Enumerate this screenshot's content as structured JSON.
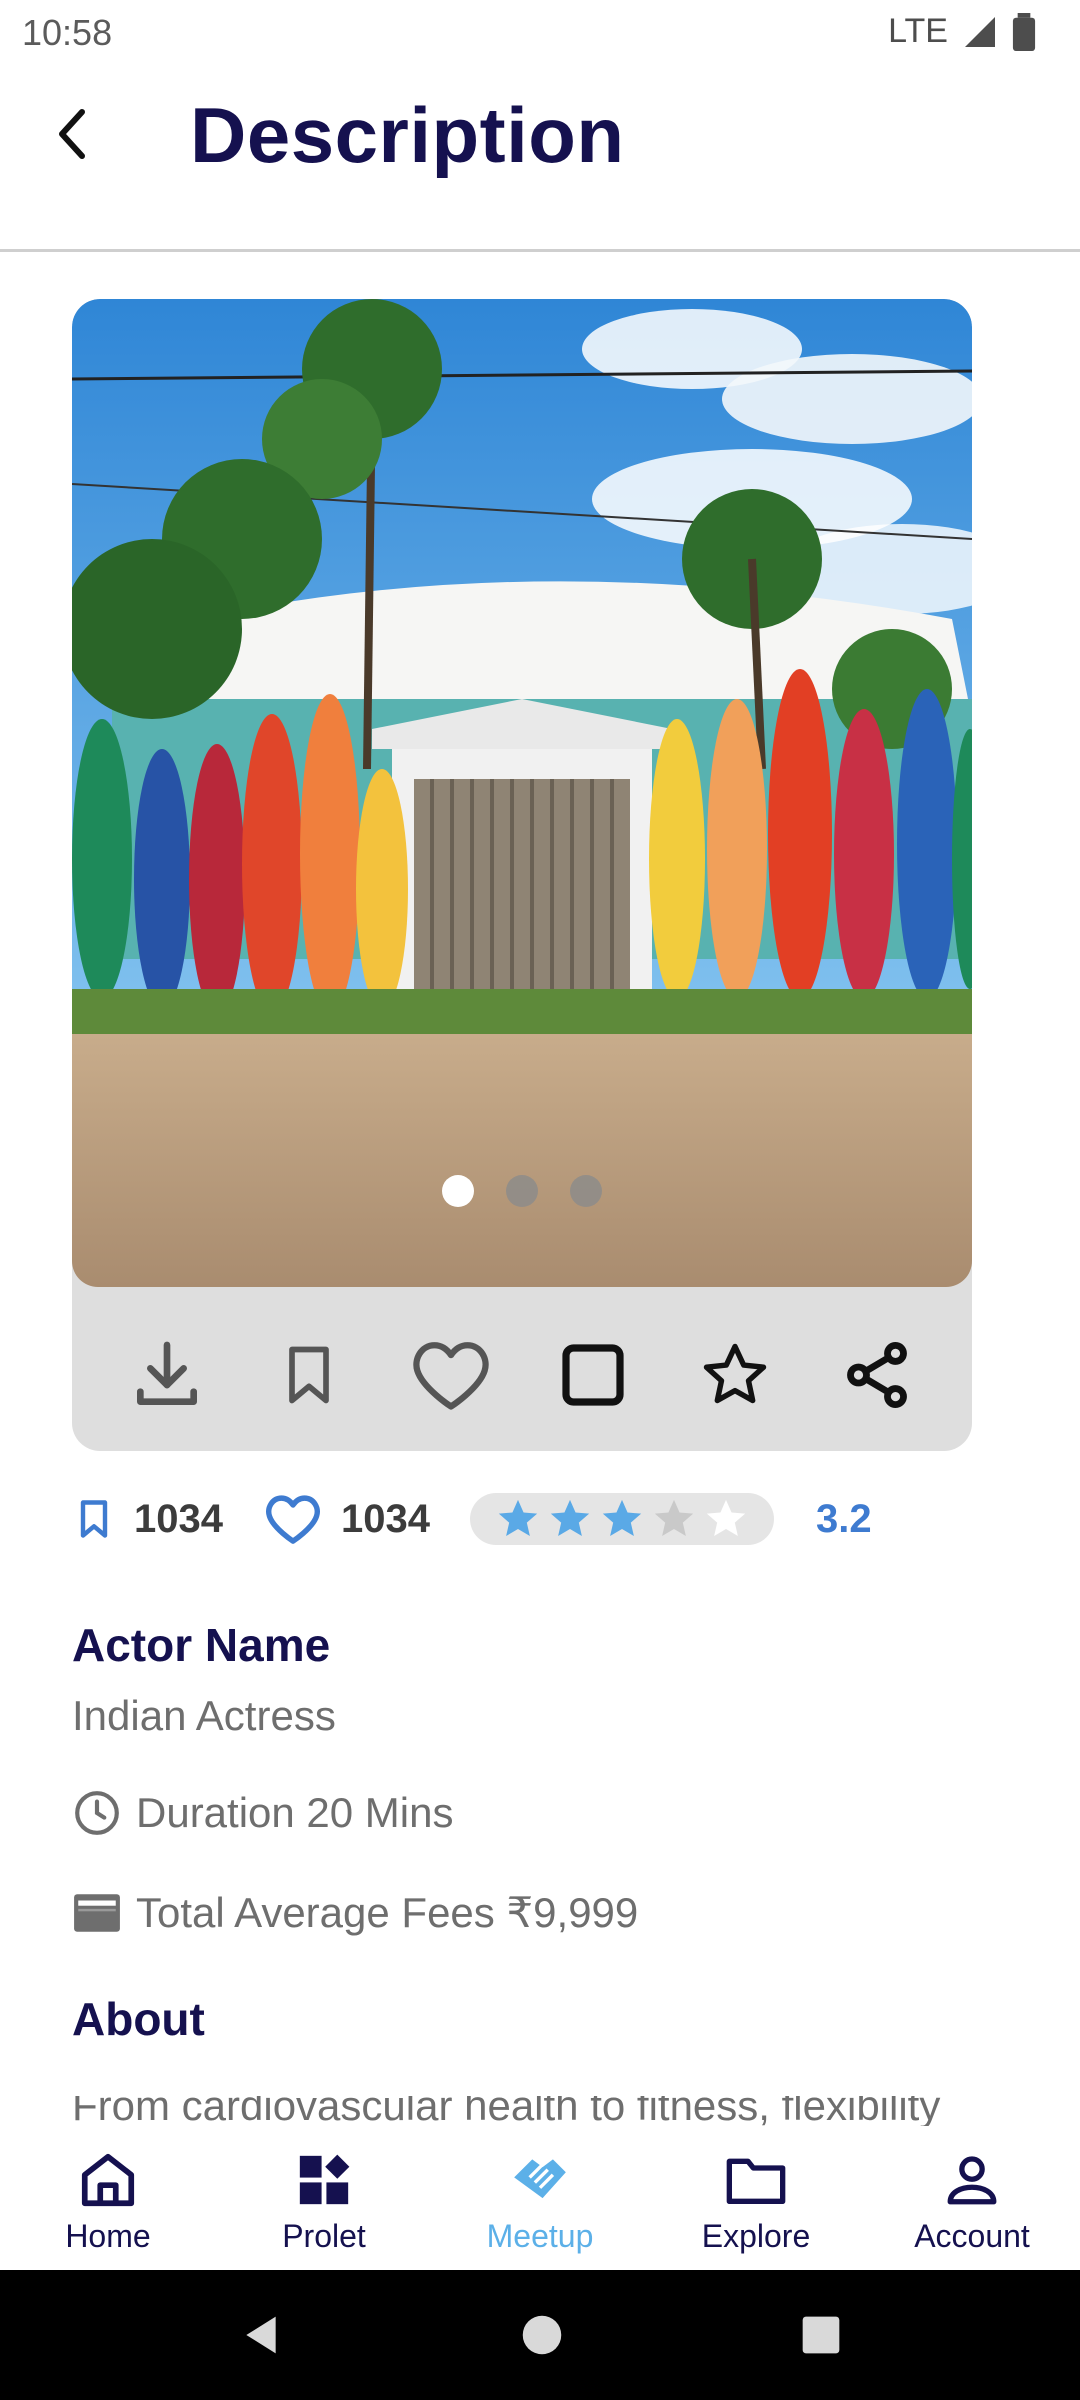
{
  "status_bar": {
    "time": "10:58",
    "network": "LTE"
  },
  "app_bar": {
    "title": "Description"
  },
  "carousel": {
    "slide_count": 3,
    "active_index": 0
  },
  "actions": [
    {
      "icon": "download-icon"
    },
    {
      "icon": "bookmark-icon"
    },
    {
      "icon": "heart-icon"
    },
    {
      "icon": "square-icon"
    },
    {
      "icon": "star-icon"
    },
    {
      "icon": "share-icon"
    }
  ],
  "stats": {
    "bookmarks": "1034",
    "likes": "1034",
    "rating_value": "3.2",
    "rating_stars": 3
  },
  "details": {
    "actor_name": "Actor Name",
    "actor_subtitle": "Indian Actress",
    "duration": "Duration 20 Mins",
    "fees": "Total Average Fees ₹9,999",
    "about_heading": "About",
    "about_text": "From cardiovascular health to fitness, flexibility"
  },
  "bottom_nav": [
    {
      "label": "Home",
      "icon": "home-icon"
    },
    {
      "label": "Prolet",
      "icon": "dashboard-icon"
    },
    {
      "label": "Meetup",
      "icon": "handshake-icon",
      "active": true
    },
    {
      "label": "Explore",
      "icon": "folder-icon"
    },
    {
      "label": "Account",
      "icon": "person-icon"
    }
  ],
  "colors": {
    "primary_text": "#15114f",
    "accent_blue": "#3e7bd0",
    "active_nav": "#5cb0e8",
    "star_fill": "#5aa9e6"
  }
}
